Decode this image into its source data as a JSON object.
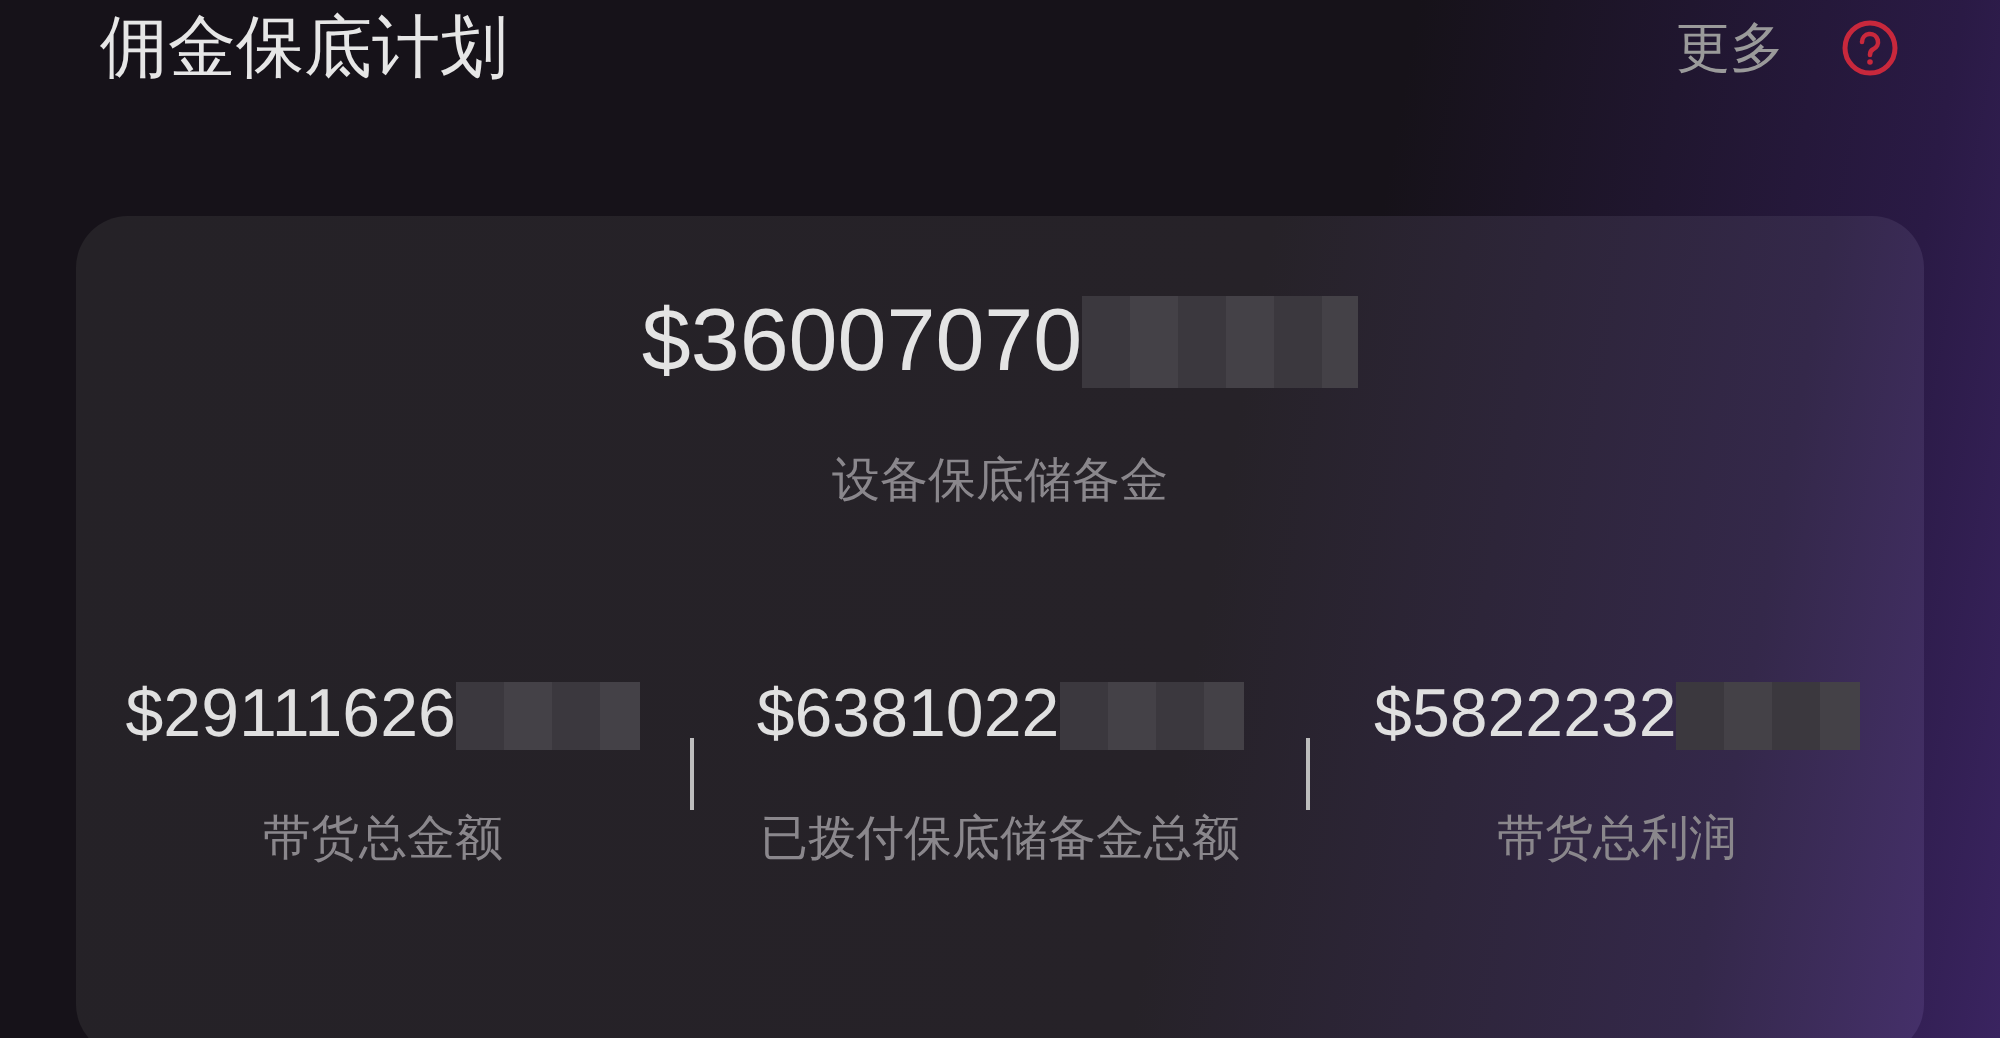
{
  "header": {
    "title": "佣金保底计划",
    "more_link": "更多"
  },
  "summary": {
    "amount": "$36007070",
    "label": "设备保底储备金"
  },
  "stats": [
    {
      "amount": "$29111626",
      "label": "带货总金额"
    },
    {
      "amount": "$6381022",
      "label": "已拨付保底储备金总额"
    },
    {
      "amount": "$5822232",
      "label": "带货总利润"
    }
  ]
}
